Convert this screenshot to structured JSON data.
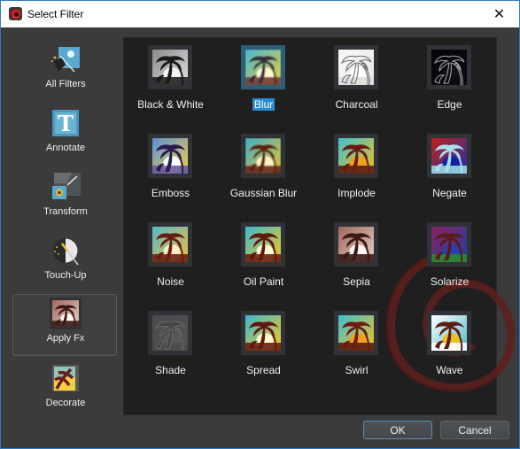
{
  "window": {
    "title": "Select Filter",
    "app_icon": "app-logo-icon",
    "close_icon": "close-icon",
    "close_glyph": "✕"
  },
  "sidebar": {
    "items": [
      {
        "label": "All Filters",
        "icon": "magic-wand-icon",
        "selected": false
      },
      {
        "label": "Annotate",
        "icon": "text-t-icon",
        "selected": false
      },
      {
        "label": "Transform",
        "icon": "transform-resize-icon",
        "selected": false
      },
      {
        "label": "Touch-Up",
        "icon": "touch-up-wand-icon",
        "selected": false
      },
      {
        "label": "Apply Fx",
        "icon": "apply-fx-palm-icon",
        "selected": true
      },
      {
        "label": "Decorate",
        "icon": "decorate-frame-icon",
        "selected": false
      }
    ]
  },
  "filters": [
    {
      "label": "Black & White",
      "style": "bw",
      "selected": false
    },
    {
      "label": "Blur",
      "style": "blur",
      "selected": true
    },
    {
      "label": "Charcoal",
      "style": "charcoal",
      "selected": false
    },
    {
      "label": "Edge",
      "style": "edge",
      "selected": false
    },
    {
      "label": "Emboss",
      "style": "emboss",
      "selected": false
    },
    {
      "label": "Gaussian Blur",
      "style": "gauss",
      "selected": false
    },
    {
      "label": "Implode",
      "style": "implode",
      "selected": false
    },
    {
      "label": "Negate",
      "style": "negate",
      "selected": false
    },
    {
      "label": "Noise",
      "style": "noise",
      "selected": false
    },
    {
      "label": "Oil Paint",
      "style": "oil",
      "selected": false
    },
    {
      "label": "Sepia",
      "style": "sepia",
      "selected": false
    },
    {
      "label": "Solarize",
      "style": "solarize",
      "selected": false
    },
    {
      "label": "Shade",
      "style": "shade",
      "selected": false
    },
    {
      "label": "Spread",
      "style": "spread",
      "selected": false
    },
    {
      "label": "Swirl",
      "style": "swirl",
      "selected": false
    },
    {
      "label": "Wave",
      "style": "wave",
      "selected": false
    }
  ],
  "buttons": {
    "ok": "OK",
    "cancel": "Cancel"
  },
  "colors": {
    "accent": "#2a8bd0",
    "window_border": "#2b78c4",
    "content_bg": "#1f1f1f",
    "swirl_decoration": "#6b2420"
  }
}
